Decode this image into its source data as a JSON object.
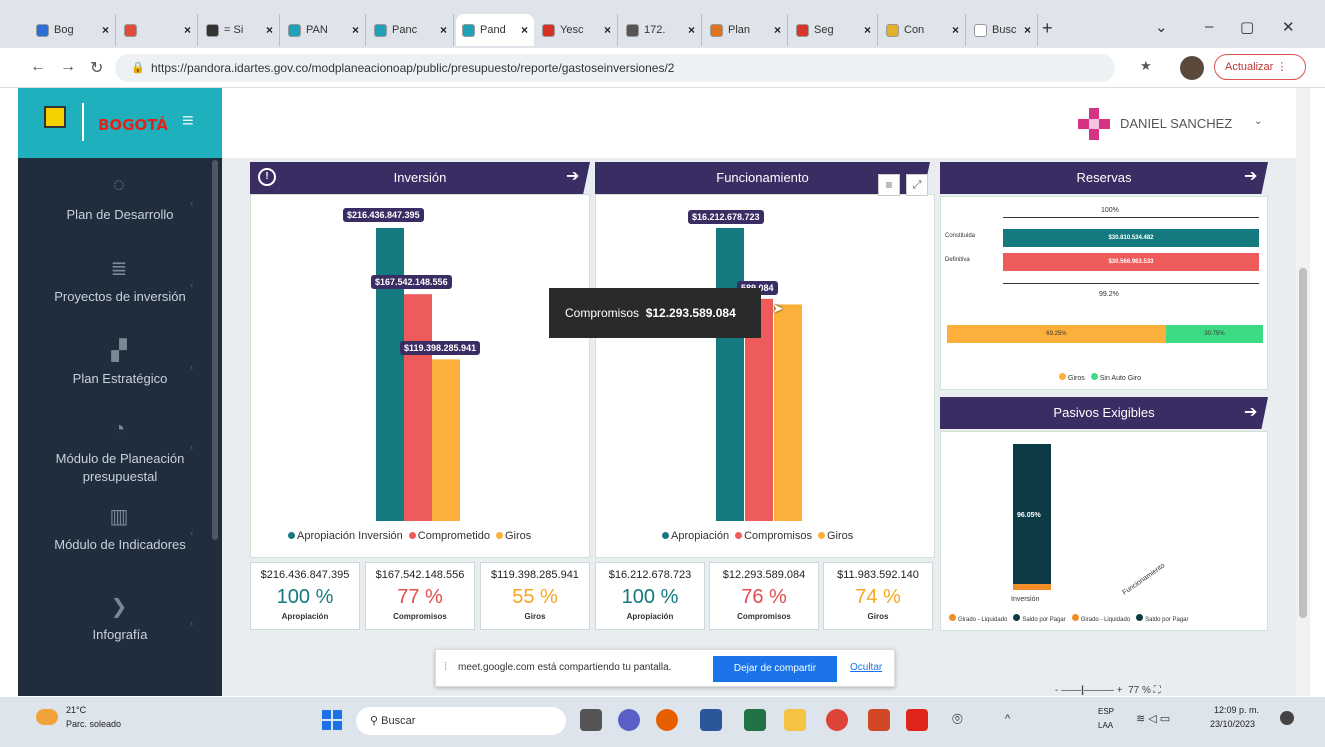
{
  "tabs": [
    {
      "label": "Bog",
      "color": "#2b6fd6"
    },
    {
      "label": "",
      "color": "#e04b3c"
    },
    {
      "label": "= Si",
      "color": "#333"
    },
    {
      "label": "PAN",
      "color": "#1fa2b8"
    },
    {
      "label": "Panc",
      "color": "#1fa2b8"
    },
    {
      "label": "Pand",
      "color": "#1fa2b8"
    },
    {
      "label": "Yesc",
      "color": "#d93025"
    },
    {
      "label": "172.",
      "color": "#555"
    },
    {
      "label": "Plan",
      "color": "#e0731f"
    },
    {
      "label": "Seg",
      "color": "#d9342b"
    },
    {
      "label": "Con",
      "color": "#e1b12c"
    },
    {
      "label": "Busc",
      "color": "#ffffff"
    }
  ],
  "url": "https://pandora.idartes.gov.co/modplaneacionoap/public/presupuesto/reporte/gastoseinversiones/2",
  "update_label": "Actualizar",
  "brand": {
    "city": "BOGOTÁ"
  },
  "user": {
    "name": "DANIEL SANCHEZ"
  },
  "sidebar": [
    {
      "label": "Plan de Desarrollo",
      "icon": "leaf-icon"
    },
    {
      "label": "Proyectos de inversión",
      "icon": "database-icon"
    },
    {
      "label": "Plan Estratégico",
      "icon": "binoculars-icon"
    },
    {
      "label": "Módulo de Planeación presupuestal",
      "icon": "clock-icon"
    },
    {
      "label": "Módulo de Indicadores",
      "icon": "bar-chart-icon"
    },
    {
      "label": "Infografía",
      "icon": "chevron-right-icon"
    }
  ],
  "inversion": {
    "title": "Inversión",
    "legend": [
      "Apropiación Inversión",
      "Comprometido",
      "Giros"
    ],
    "chart_data": {
      "type": "bar",
      "categories": [
        "Inversión"
      ],
      "series": [
        {
          "name": "Apropiación Inversión",
          "values": [
            216436847395
          ],
          "label": "$216.436.847.395",
          "color": "#147a7f"
        },
        {
          "name": "Comprometido",
          "values": [
            167542148556
          ],
          "label": "$167.542.148.556",
          "color": "#ee5b5b"
        },
        {
          "name": "Giros",
          "values": [
            119398285941
          ],
          "label": "$119.398.285.941",
          "color": "#fbb03b"
        }
      ]
    },
    "cards": [
      {
        "value": "$216.436.847.395",
        "pct": "100 %",
        "name": "Apropiación",
        "color": "#147a7f"
      },
      {
        "value": "$167.542.148.556",
        "pct": "77 %",
        "name": "Compromisos",
        "color": "#e04e4e"
      },
      {
        "value": "$119.398.285.941",
        "pct": "55 %",
        "name": "Giros",
        "color": "#f6a623"
      }
    ]
  },
  "funcionamiento": {
    "title": "Funcionamiento",
    "legend": [
      "Apropiación",
      "Compromisos",
      "Giros"
    ],
    "chart_data": {
      "type": "bar",
      "categories": [
        "Funcionamiento"
      ],
      "series": [
        {
          "name": "Apropiación",
          "values": [
            16212678723
          ],
          "label": "$16.212.678.723",
          "color": "#147a7f"
        },
        {
          "name": "Compromisos",
          "values": [
            12293589084
          ],
          "label": "589.084",
          "color": "#ee5b5b"
        },
        {
          "name": "Giros",
          "values": [
            11983592140
          ],
          "color": "#fbb03b"
        }
      ]
    },
    "tooltip": {
      "name": "Compromisos",
      "value": "$12.293.589.084"
    },
    "cards": [
      {
        "value": "$16.212.678.723",
        "pct": "100 %",
        "name": "Apropiación",
        "color": "#147a7f"
      },
      {
        "value": "$12.293.589.084",
        "pct": "76 %",
        "name": "Compromisos",
        "color": "#e04e4e"
      },
      {
        "value": "$11.983.592.140",
        "pct": "74 %",
        "name": "Giros",
        "color": "#f6a623"
      }
    ]
  },
  "reservas": {
    "title": "Reservas",
    "top_pct": "100%",
    "bottom_pct": "99.2%",
    "rows": [
      {
        "label": "Constituida",
        "value": "$30.810.534.482",
        "color": "#147a7f"
      },
      {
        "label": "Definitiva",
        "value": "$30.566.963.533",
        "color": "#ee5b5b"
      }
    ],
    "split": [
      {
        "pct": "69.25%",
        "frac": 0.6925,
        "color": "#fbb03b"
      },
      {
        "pct": "30.75%",
        "frac": 0.3075,
        "color": "#3ddc84"
      }
    ],
    "legend": [
      "Giros",
      "Sin Auto Giro"
    ]
  },
  "pasivos": {
    "title": "Pasivos Exigibles",
    "bar_label": "96.05%",
    "x1": "Inversión",
    "x2": "Funcionamiento",
    "legend": [
      "Girado - Liquidado",
      "Saldo por Pagar",
      "Girado - Liquidado",
      "Saldo por Pagar"
    ]
  },
  "share": {
    "text": "meet.google.com está compartiendo tu pantalla.",
    "stop": "Dejar de compartir",
    "hide": "Ocultar"
  },
  "zoom": "77 %",
  "taskbar": {
    "temp": "21°C",
    "weather": "Parc. soleado",
    "search": "Buscar",
    "lang1": "ESP",
    "lang2": "LAA",
    "time": "12:09 p. m.",
    "date": "23/10/2023"
  }
}
